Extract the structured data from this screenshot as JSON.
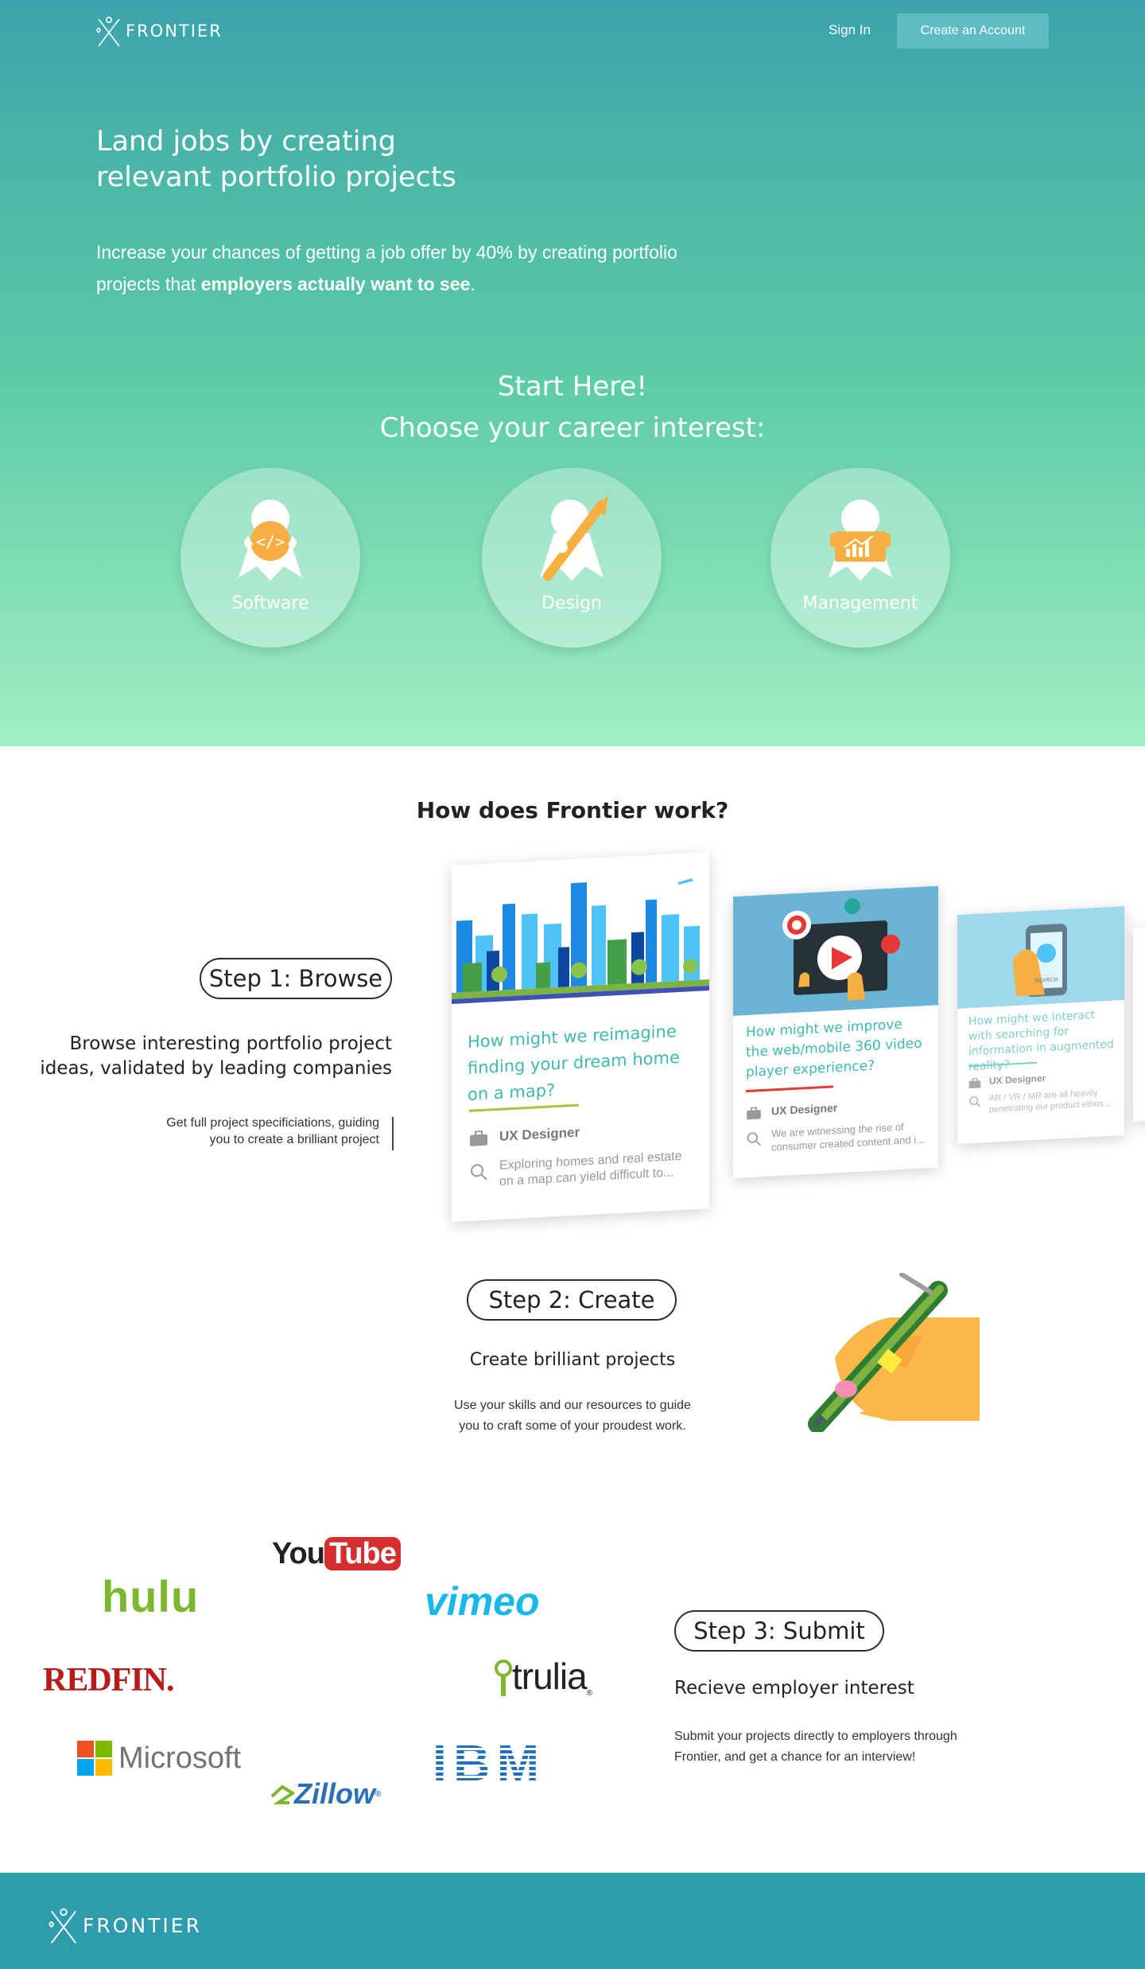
{
  "nav": {
    "brand": "FRONTIER",
    "sign_in": "Sign In",
    "create_account": "Create an Account"
  },
  "hero": {
    "title_line1": "Land jobs by creating",
    "title_line2": "relevant portfolio projects",
    "sub_text1": "Increase your chances of getting a job offer by 40% by creating portfolio projects that ",
    "sub_bold": "employers actually want to see",
    "sub_end": ".",
    "start_here": "Start Here!",
    "choose": "Choose your career interest:",
    "interests": [
      {
        "label": "Software",
        "icon": "code-icon"
      },
      {
        "label": "Design",
        "icon": "paintbrush-icon"
      },
      {
        "label": "Management",
        "icon": "chart-icon"
      }
    ]
  },
  "how": {
    "title": "How does Frontier work?",
    "step1": {
      "pill": "Step 1: Browse",
      "heading_line1": "Browse interesting portfolio project",
      "heading_line2": "ideas, validated by leading companies",
      "desc_line1": "Get full project specificiations, guiding",
      "desc_line2": "you to create a brilliant project"
    },
    "cards": [
      {
        "title": "How might we reimagine finding your dream home on a map?",
        "role": "UX Designer",
        "summary": "Exploring homes and real estate on a map can yield difficult to..."
      },
      {
        "title": "How might we improve the web/mobile 360 video player experience?",
        "role": "UX Designer",
        "summary": "We are witnessing the rise of consumer created content and i..."
      },
      {
        "title": "How might we interact with searching for information in augmented reality?",
        "role": "UX Designer",
        "summary": "AR / VR / MR are all heavily penetrating our product ethos...",
        "search_label": "SEARCH"
      }
    ],
    "step2": {
      "pill": "Step 2: Create",
      "heading": "Create brilliant projects",
      "desc_line1": "Use your skills and our resources to guide",
      "desc_line2": "you to craft some of your proudest work."
    },
    "step3": {
      "pill": "Step 3: Submit",
      "heading": "Recieve employer interest",
      "desc_line1": "Submit your projects directly to employers through",
      "desc_line2": "Frontier, and get a chance for an interview!"
    }
  },
  "logos": {
    "youtube_you": "You",
    "youtube_tube": "Tube",
    "hulu": "hulu",
    "vimeo": "vimeo",
    "redfin": "REDFIN",
    "redfin_dot": ".",
    "trulia": "trulia",
    "trulia_mark": "®",
    "microsoft": "Microsoft",
    "ibm": "IBM",
    "zillow": "Zillow",
    "zillow_mark": "®"
  },
  "footer": {
    "brand": "FRONTIER"
  },
  "colors": {
    "teal_top": "#3aa3ad",
    "mint_bottom": "#a3eec8",
    "accent_teal": "#3fb8b0",
    "orange": "#f5b041",
    "footer": "#2f9cae"
  }
}
